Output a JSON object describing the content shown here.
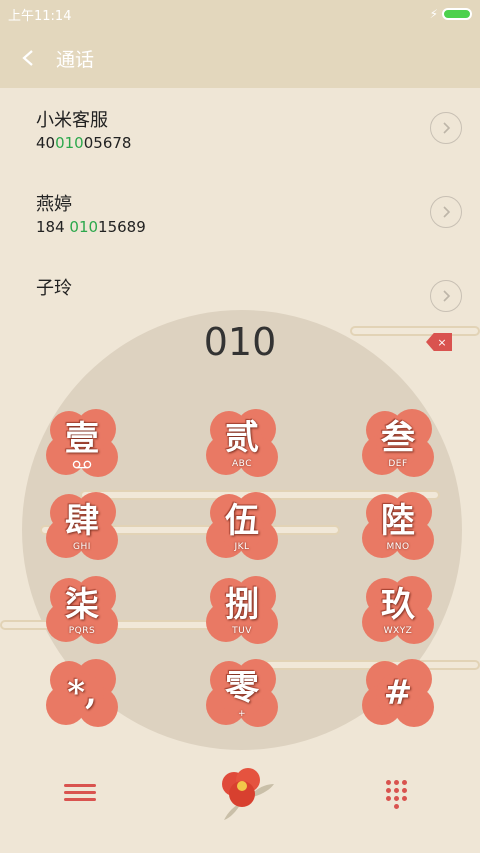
{
  "status_bar": {
    "time": "上午11:14"
  },
  "header": {
    "title": "通话"
  },
  "contacts": [
    {
      "name": "小米客服",
      "num_pre": "40",
      "num_hl": "010",
      "num_post": "05678"
    },
    {
      "name": "燕婷",
      "num_pre": "184 ",
      "num_hl": "010",
      "num_post": "15689"
    },
    {
      "name": "子玲",
      "num_pre": "",
      "num_hl": "",
      "num_post": ""
    }
  ],
  "dialer": {
    "input": "010",
    "delete_icon": "×",
    "keys": [
      {
        "char": "壹",
        "sub": ""
      },
      {
        "char": "贰",
        "sub": "ABC"
      },
      {
        "char": "叁",
        "sub": "DEF"
      },
      {
        "char": "肆",
        "sub": "GHI"
      },
      {
        "char": "伍",
        "sub": "JKL"
      },
      {
        "char": "陸",
        "sub": "MNO"
      },
      {
        "char": "柒",
        "sub": "PQRS"
      },
      {
        "char": "捌",
        "sub": "TUV"
      },
      {
        "char": "玖",
        "sub": "WXYZ"
      },
      {
        "char": "*,",
        "sub": ""
      },
      {
        "char": "零",
        "sub": "+"
      },
      {
        "char": "#",
        "sub": ""
      }
    ]
  },
  "colors": {
    "accent": "#d9534f",
    "highlight": "#2ca84c",
    "header_bg": "#e3d7bd"
  },
  "icons": {
    "back": "chevron-left-icon",
    "detail": "chevron-right-icon",
    "voicemail": "voicemail-icon",
    "menu": "menu-icon",
    "dialpad": "dialpad-icon",
    "call": "flower-call-icon"
  }
}
